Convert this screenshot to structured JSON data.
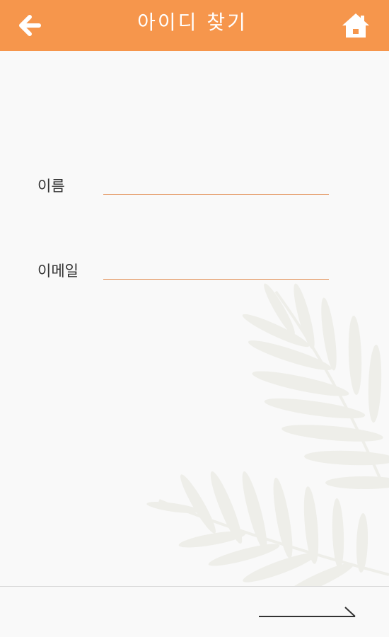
{
  "header": {
    "title": "아이디 찾기",
    "back_icon": "arrow-left-icon",
    "home_icon": "home-icon",
    "background_color": "#f6964c"
  },
  "form": {
    "name_label": "이름",
    "name_value": "",
    "email_label": "이메일",
    "email_value": "",
    "underline_color": "#e0884a"
  },
  "footer": {
    "next_icon": "long-arrow-right-icon"
  },
  "background": {
    "decoration": "palm-leaf-watermark"
  }
}
